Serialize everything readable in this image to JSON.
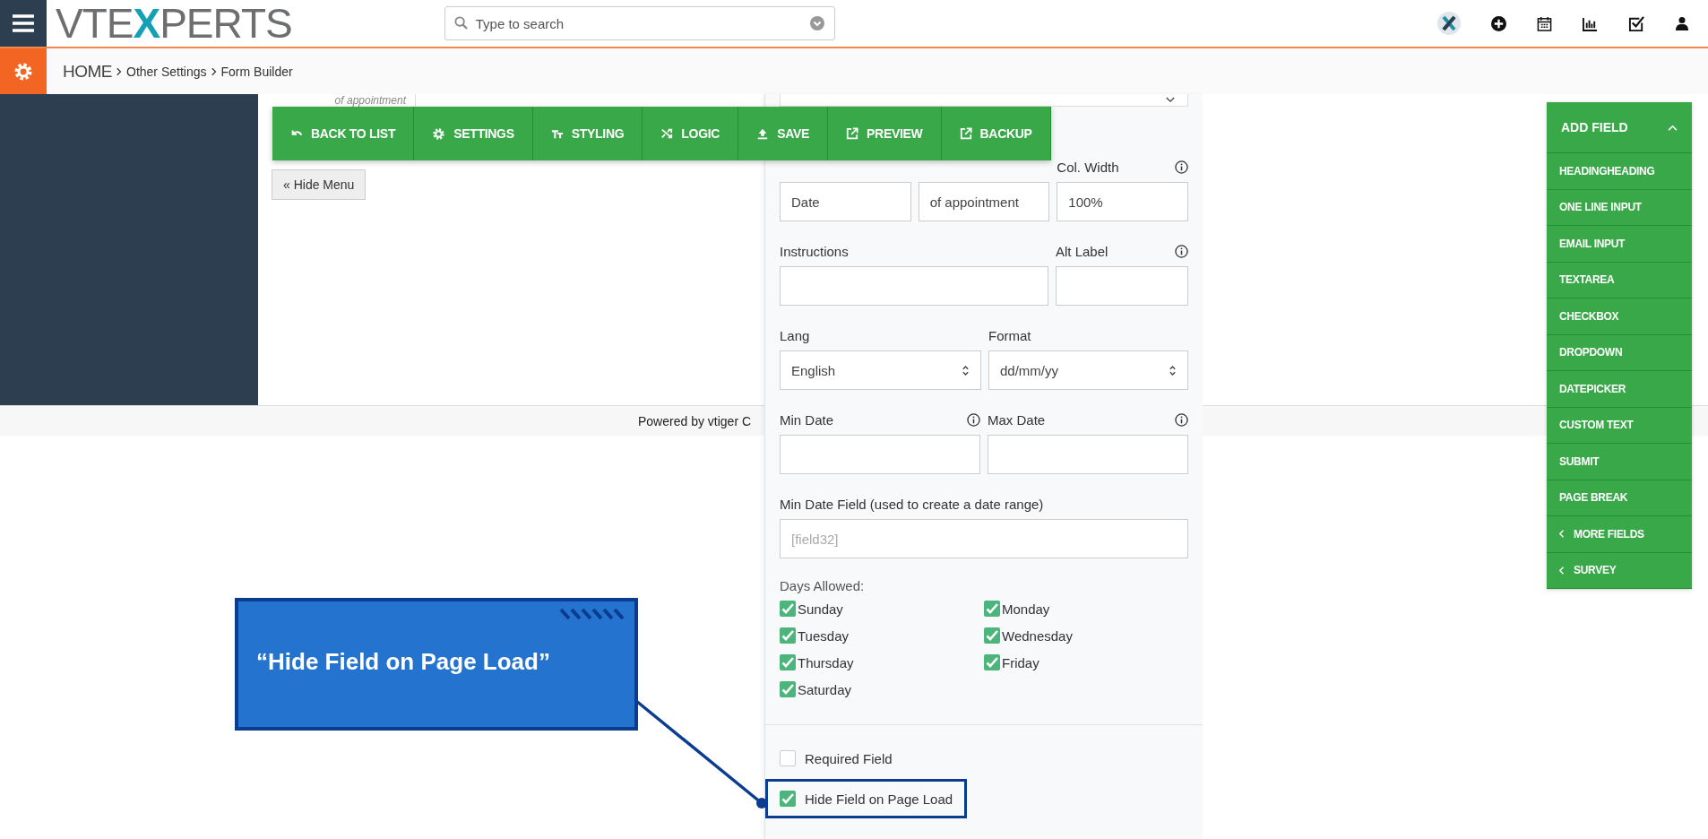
{
  "header": {
    "logo": [
      "VTE",
      "X",
      "PERTS"
    ],
    "search": {
      "placeholder": "Type to search"
    }
  },
  "breadcrumb": [
    "HOME",
    "Other Settings",
    "Form Builder"
  ],
  "canvas": {
    "partial_field": "of appointment",
    "hide_menu": "« Hide Menu",
    "footer": "Powered by vtiger C"
  },
  "toolbar": [
    {
      "label": "BACK TO LIST",
      "kind": "back"
    },
    {
      "label": "SETTINGS",
      "kind": "settings"
    },
    {
      "label": "STYLING",
      "kind": "styling"
    },
    {
      "label": "LOGIC",
      "kind": "logic"
    },
    {
      "label": "SAVE",
      "kind": "save"
    },
    {
      "label": "PREVIEW",
      "kind": "preview"
    },
    {
      "label": "BACKUP",
      "kind": "backup"
    }
  ],
  "field_settings": {
    "rows": [
      {
        "columns": [
          {
            "kind": "text",
            "info": false,
            "value": "Date"
          },
          {
            "kind": "text",
            "info": false,
            "value": "of appointment"
          },
          {
            "kind": "text",
            "label": "Col. Width",
            "info": true,
            "value": "100%"
          }
        ]
      },
      {
        "columns": [
          {
            "kind": "text",
            "label": "Instructions",
            "info": false
          },
          {
            "kind": "text",
            "label": "Alt Label",
            "info": true
          }
        ]
      },
      {
        "columns": [
          {
            "kind": "select",
            "label": "Lang",
            "info": false,
            "value": "English"
          },
          {
            "kind": "select",
            "label": "Format",
            "info": false,
            "value": "dd/mm/yy"
          }
        ]
      },
      {
        "columns": [
          {
            "kind": "text",
            "label": "Min Date",
            "info": true
          },
          {
            "kind": "text",
            "label": "Max Date",
            "info": true
          }
        ]
      },
      {
        "columns": [
          {
            "kind": "text",
            "label": "Min Date Field (used to create a date range)",
            "info": false,
            "placeholder": "[field32]"
          }
        ]
      }
    ],
    "days_label": "Days Allowed:",
    "days": [
      {
        "label": "Sunday",
        "checked": true
      },
      {
        "label": "Monday",
        "checked": true
      },
      {
        "label": "Tuesday",
        "checked": true
      },
      {
        "label": "Wednesday",
        "checked": true
      },
      {
        "label": "Thursday",
        "checked": true
      },
      {
        "label": "Friday",
        "checked": true
      },
      {
        "label": "Saturday",
        "checked": true
      }
    ],
    "options": [
      {
        "label": "Required Field",
        "checked": false,
        "highlighted": false
      },
      {
        "label": "Hide Field on Page Load",
        "checked": true,
        "highlighted": true
      }
    ]
  },
  "add_field": {
    "title": "ADD FIELD",
    "expanded": true,
    "items": [
      {
        "label": "HEADINGHEADING",
        "kind": "field"
      },
      {
        "label": "ONE LINE INPUT",
        "kind": "field"
      },
      {
        "label": "EMAIL INPUT",
        "kind": "field"
      },
      {
        "label": "TEXTAREA",
        "kind": "field"
      },
      {
        "label": "CHECKBOX",
        "kind": "field"
      },
      {
        "label": "DROPDOWN",
        "kind": "field"
      },
      {
        "label": "DATEPICKER",
        "kind": "field"
      },
      {
        "label": "CUSTOM TEXT",
        "kind": "field"
      },
      {
        "label": "SUBMIT",
        "kind": "field"
      },
      {
        "label": "PAGE BREAK",
        "kind": "field"
      },
      {
        "label": "MORE FIELDS",
        "kind": "group"
      },
      {
        "label": "SURVEY",
        "kind": "group"
      }
    ]
  },
  "callout": {
    "text": "“Hide Field on Page Load”"
  }
}
